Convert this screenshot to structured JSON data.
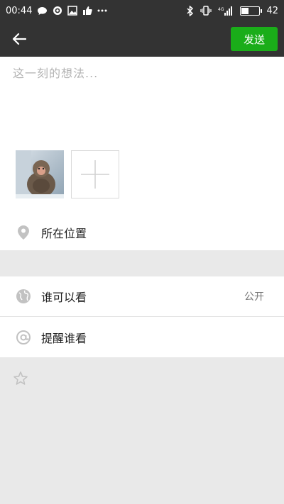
{
  "status_bar": {
    "time": "00:44",
    "signal": "4G",
    "battery_text": "42",
    "battery_level": 0.42
  },
  "title_bar": {
    "send_label": "发送"
  },
  "compose": {
    "placeholder": "这一刻的想法..."
  },
  "location": {
    "label": "所在位置"
  },
  "settings": {
    "visibility_label": "谁可以看",
    "visibility_value": "公开",
    "remind_label": "提醒谁看"
  },
  "colors": {
    "header_bg": "#333333",
    "send_green": "#1aad19",
    "page_bg": "#e9e9e9",
    "icon_gray": "#c2c2c2"
  }
}
